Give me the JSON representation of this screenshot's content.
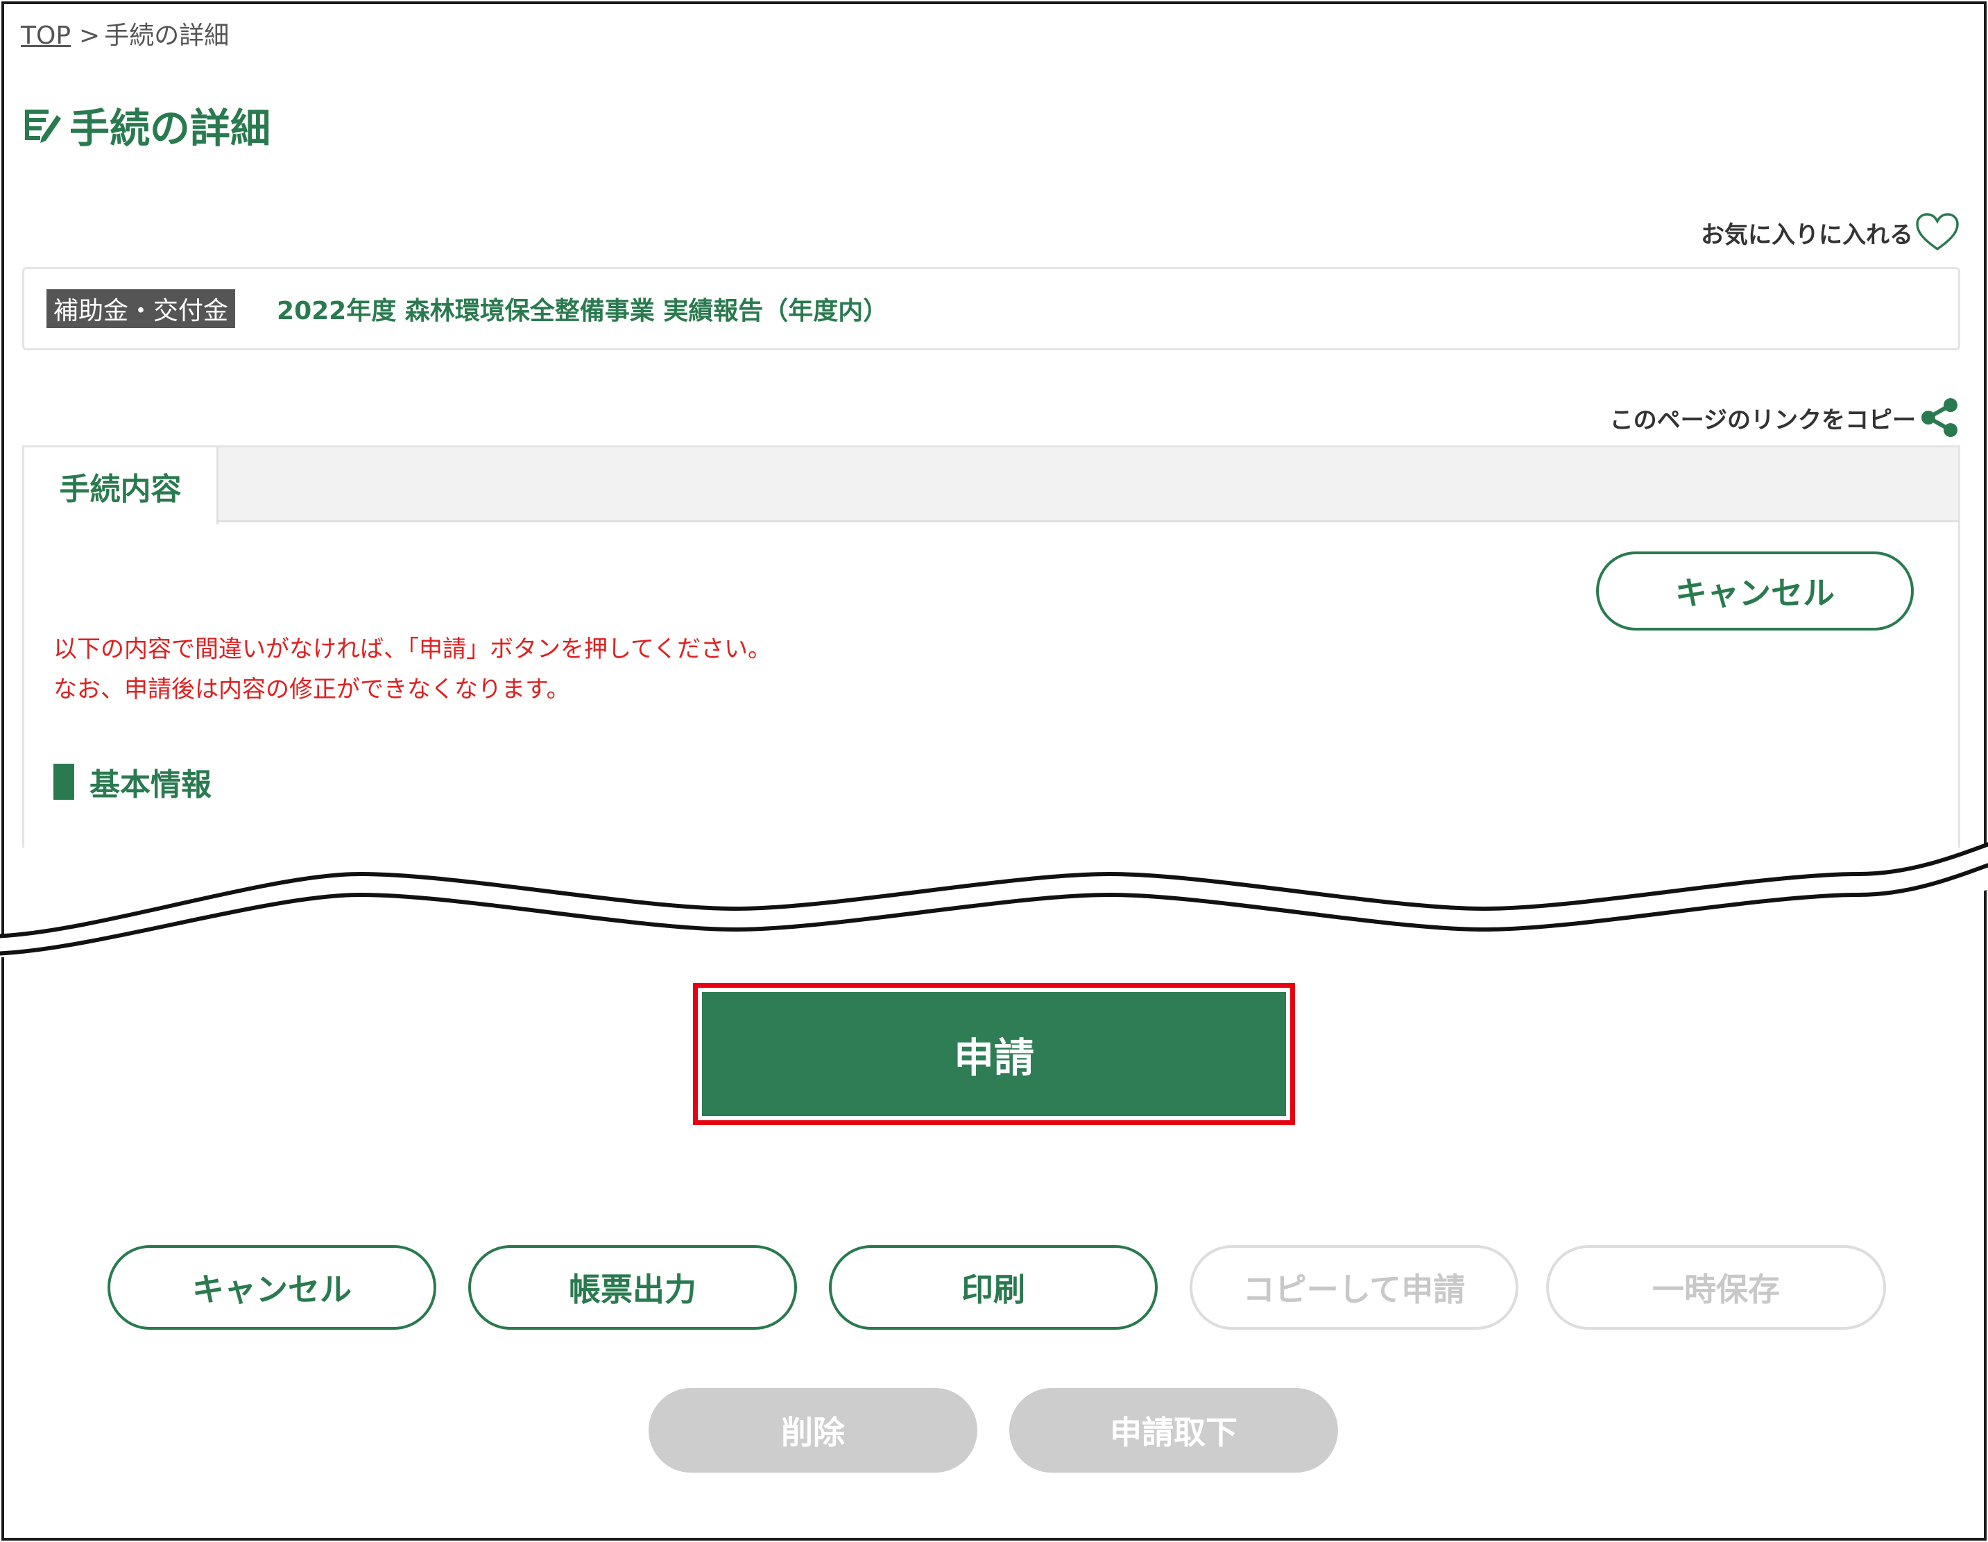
{
  "breadcrumb": {
    "top": "TOP",
    "separator": ">",
    "current": "手続の詳細"
  },
  "page_title": "手続の詳細",
  "favorite": {
    "label": "お気に入りに入れる",
    "icon": "heart-icon"
  },
  "procedure": {
    "category": "補助金・交付金",
    "name": "2022年度 森林環境保全整備事業 実績報告（年度内）"
  },
  "copy_link": {
    "label": "このページのリンクをコピー",
    "icon": "share-icon"
  },
  "tabs": [
    {
      "label": "手続内容",
      "active": true
    }
  ],
  "top_cancel_label": "キャンセル",
  "notice": {
    "line1": "以下の内容で間違いがなければ、「申請」ボタンを押してください。",
    "line2": "なお、申請後は内容の修正ができなくなります。"
  },
  "section_title": "基本情報",
  "apply_button": "申請",
  "buttons": {
    "cancel": "キャンセル",
    "form_output": "帳票出力",
    "print": "印刷",
    "copy_apply": "コピーして申請",
    "temp_save": "一時保存",
    "delete": "削除",
    "withdraw": "申請取下"
  },
  "colors": {
    "primary_green": "#2a7a4f",
    "apply_green": "#2e7d55",
    "notice_red": "#e02020",
    "highlight_red": "#e60012",
    "disabled_gray": "#cdcdcd"
  }
}
